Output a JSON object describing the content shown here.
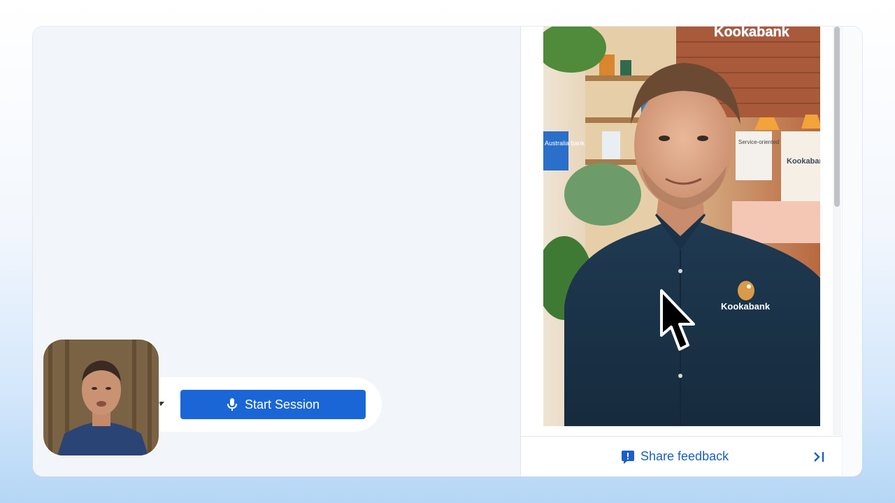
{
  "session": {
    "start_label": "Start Session",
    "icon": "microphone-icon"
  },
  "audio": {
    "icon": "speaker-icon",
    "dropdown_icon": "caret-down-icon"
  },
  "feedback": {
    "label": "Share feedback",
    "icon": "feedback-icon",
    "collapse_icon": "collapse-panel-icon"
  },
  "avatar": {
    "sign_text": "Kookabank",
    "shirt_logo": "Kookabank",
    "poster_text": "Service-oriented bank",
    "side_poster": "Australia bank",
    "brand_text": "Kookabank"
  },
  "colors": {
    "accent": "#1a66d6",
    "link": "#1a5fc8",
    "shirt": "#1c3448"
  }
}
